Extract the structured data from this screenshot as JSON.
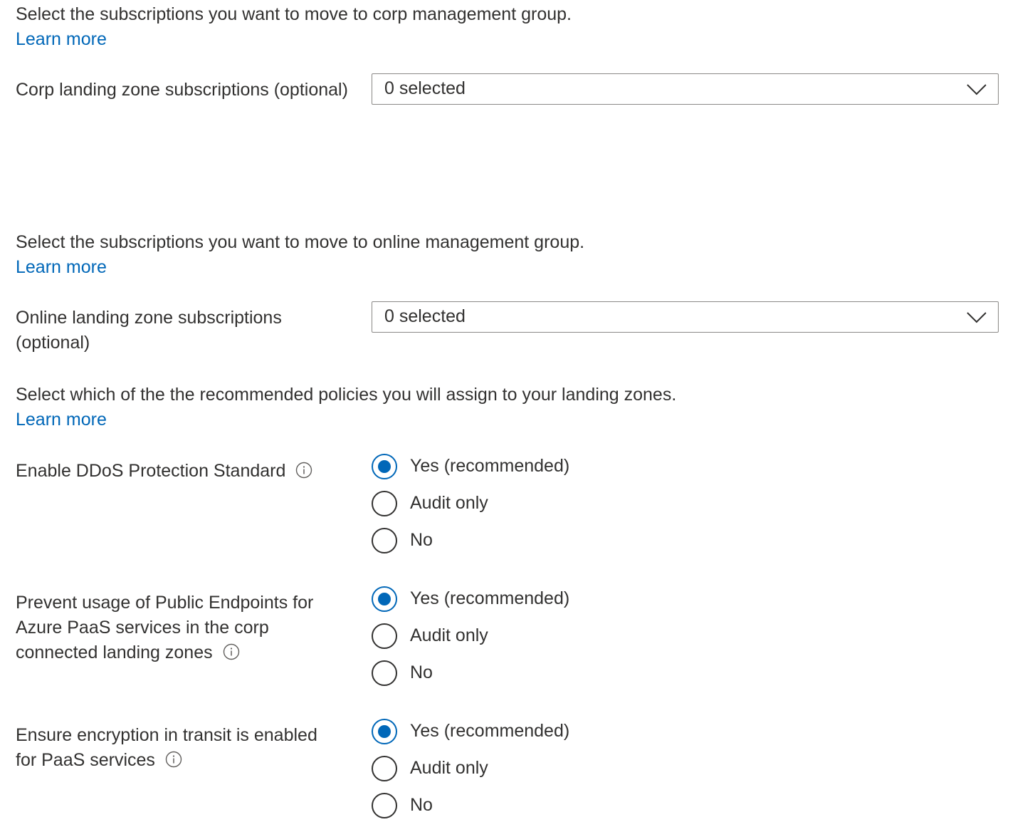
{
  "corp_section": {
    "intro": "Select the subscriptions you want to move to corp management group.",
    "learn_more": "Learn more",
    "field_label": "Corp landing zone subscriptions (optional)",
    "dropdown_value": "0 selected"
  },
  "online_section": {
    "intro": "Select the subscriptions you want to move to online management group.",
    "learn_more": "Learn more",
    "field_label": "Online landing zone subscriptions (optional)",
    "dropdown_value": "0 selected"
  },
  "policies_section": {
    "intro": "Select which of the the recommended policies you will assign to your landing zones.",
    "learn_more": "Learn more",
    "policies": [
      {
        "label": "Enable DDoS Protection Standard",
        "options": [
          "Yes (recommended)",
          "Audit only",
          "No"
        ],
        "selected": "Yes (recommended)"
      },
      {
        "label": "Prevent usage of Public Endpoints for Azure PaaS services in the corp connected landing zones",
        "options": [
          "Yes (recommended)",
          "Audit only",
          "No"
        ],
        "selected": "Yes (recommended)"
      },
      {
        "label": "Ensure encryption in transit is enabled for PaaS services",
        "options": [
          "Yes (recommended)",
          "Audit only",
          "No"
        ],
        "selected": "Yes (recommended)"
      }
    ]
  },
  "icons": {
    "info": "info-icon",
    "dropdown": "chevron-down-icon"
  },
  "colors": {
    "accent": "#0067b8",
    "text": "#323130",
    "border": "#8a8886"
  }
}
